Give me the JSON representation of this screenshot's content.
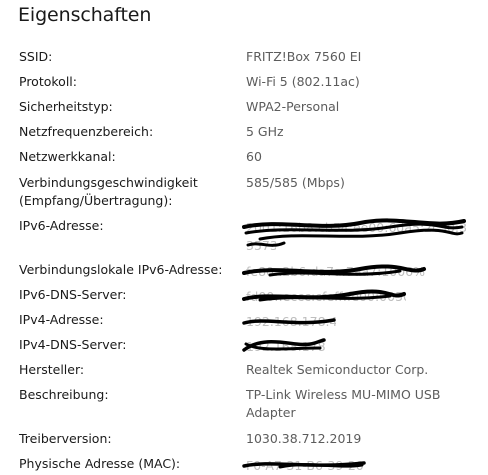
{
  "title": "Eigenschaften",
  "properties": [
    {
      "label": "SSID:",
      "value": "FRITZ!Box 7560 EI"
    },
    {
      "label": "Protokoll:",
      "value": "Wi-Fi 5 (802.11ac)"
    },
    {
      "label": "Sicherheitstyp:",
      "value": "WPA2-Personal"
    },
    {
      "label": "Netzfrequenzbereich:",
      "value": "5 GHz"
    },
    {
      "label": "Netzwerkkanal:",
      "value": "60"
    },
    {
      "label": "Verbindungsgeschwindigkeit (Empfang/Übertragung):",
      "value": "585/585 (Mbps)"
    },
    {
      "label": "IPv6-Adresse:",
      "value": "",
      "redacted": true
    },
    {
      "label": "Verbindungslokale IPv6-Adresse:",
      "value": "",
      "redacted": true
    },
    {
      "label": "IPv6-DNS-Server:",
      "value": "",
      "redacted": true
    },
    {
      "label": "IPv4-Adresse:",
      "value": "",
      "redacted": true
    },
    {
      "label": "IPv4-DNS-Server:",
      "value": "",
      "redacted": true
    },
    {
      "label": "Hersteller:",
      "value": "Realtek Semiconductor Corp."
    },
    {
      "label": "Beschreibung:",
      "value": "TP-Link Wireless MU-MIMO USB Adapter"
    },
    {
      "label": "Treiberversion:",
      "value": "1030.38.712.2019"
    },
    {
      "label": "Physische Adresse (MAC):",
      "value": "",
      "redacted": true
    }
  ],
  "colors": {
    "label": "#1a1a1a",
    "value": "#5c5c5c",
    "scribble": "#000000"
  }
}
